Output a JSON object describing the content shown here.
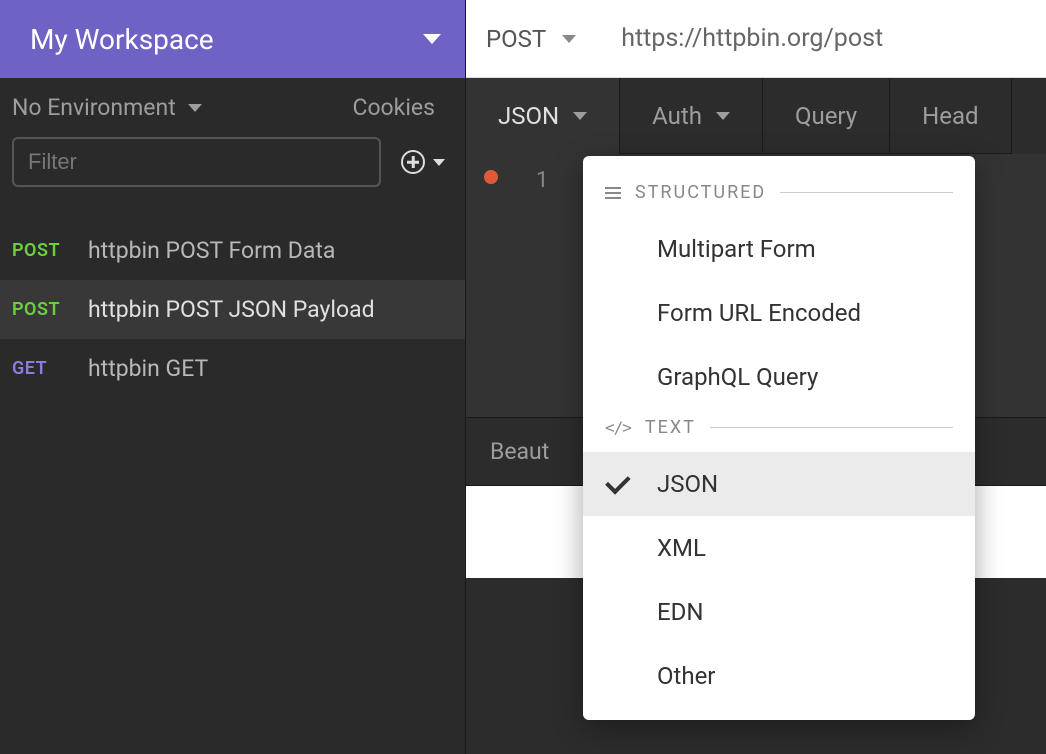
{
  "workspace": {
    "title": "My Workspace"
  },
  "sidebar": {
    "environment_label": "No Environment",
    "cookies_label": "Cookies",
    "filter_placeholder": "Filter",
    "requests": [
      {
        "method": "POST",
        "method_class": "method-post",
        "name": "httpbin POST Form Data",
        "active": false
      },
      {
        "method": "POST",
        "method_class": "method-post",
        "name": "httpbin POST JSON Payload",
        "active": true
      },
      {
        "method": "GET",
        "method_class": "method-get",
        "name": "httpbin GET",
        "active": false
      }
    ]
  },
  "request": {
    "method": "POST",
    "url": "https://httpbin.org/post"
  },
  "tabs": [
    {
      "label": "JSON",
      "active": true,
      "has_caret": true
    },
    {
      "label": "Auth",
      "active": false,
      "has_caret": true
    },
    {
      "label": "Query",
      "active": false,
      "has_caret": false
    },
    {
      "label": "Head",
      "active": false,
      "has_caret": false
    }
  ],
  "editor": {
    "line_number": "1"
  },
  "lower_bar": {
    "beautify_label": "Beaut"
  },
  "dropdown": {
    "sections": [
      {
        "title": "STRUCTURED",
        "icon": "hamburger",
        "items": [
          {
            "label": "Multipart Form",
            "selected": false
          },
          {
            "label": "Form URL Encoded",
            "selected": false
          },
          {
            "label": "GraphQL Query",
            "selected": false
          }
        ]
      },
      {
        "title": "TEXT",
        "icon": "code",
        "items": [
          {
            "label": "JSON",
            "selected": true
          },
          {
            "label": "XML",
            "selected": false
          },
          {
            "label": "EDN",
            "selected": false
          },
          {
            "label": "Other",
            "selected": false
          }
        ]
      }
    ]
  }
}
